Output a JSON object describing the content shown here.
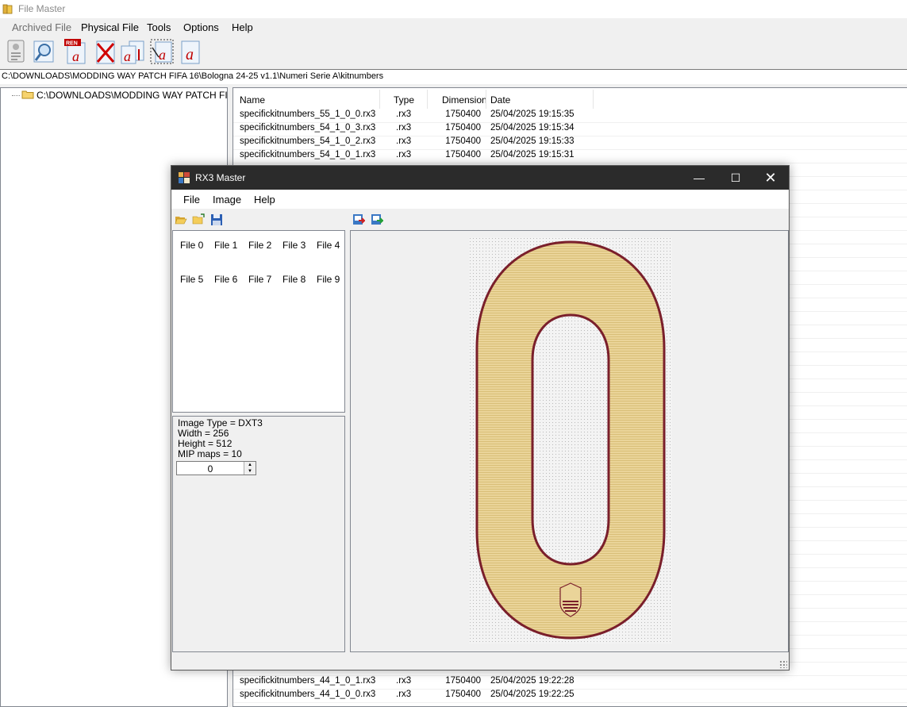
{
  "main": {
    "title": "File Master",
    "menu": [
      "Archived File",
      "Physical File",
      "Tools",
      "Options",
      "Help"
    ],
    "path": "C:\\DOWNLOADS\\MODDING WAY PATCH FIFA 16\\Bologna 24-25 v1.1\\Numeri Serie A\\kitnumbers",
    "tree_root": "C:\\DOWNLOADS\\MODDING WAY PATCH FIFA",
    "columns": {
      "name": "Name",
      "type": "Type",
      "dimension": "Dimension",
      "date": "Date"
    },
    "files_top": [
      {
        "name": "specifickitnumbers_55_1_0_0.rx3",
        "type": ".rx3",
        "dimension": "1750400",
        "date": "25/04/2025 19:15:35"
      },
      {
        "name": "specifickitnumbers_54_1_0_3.rx3",
        "type": ".rx3",
        "dimension": "1750400",
        "date": "25/04/2025 19:15:34"
      },
      {
        "name": "specifickitnumbers_54_1_0_2.rx3",
        "type": ".rx3",
        "dimension": "1750400",
        "date": "25/04/2025 19:15:33"
      },
      {
        "name": "specifickitnumbers_54_1_0_1.rx3",
        "type": ".rx3",
        "dimension": "1750400",
        "date": "25/04/2025 19:15:31"
      }
    ],
    "files_bottom": [
      {
        "name": "specifickitnumbers_44_1_0_1.rx3",
        "type": ".rx3",
        "dimension": "1750400",
        "date": "25/04/2025 19:22:28"
      },
      {
        "name": "specifickitnumbers_44_1_0_0.rx3",
        "type": ".rx3",
        "dimension": "1750400",
        "date": "25/04/2025 19:22:25"
      }
    ],
    "toolbar_badge": "REN"
  },
  "rx3": {
    "title": "RX3 Master",
    "menu": [
      "File",
      "Image",
      "Help"
    ],
    "files": [
      "File 0",
      "File 1",
      "File 2",
      "File 3",
      "File 4",
      "File 5",
      "File 6",
      "File 7",
      "File 8",
      "File 9"
    ],
    "info": {
      "image_type": "Image Type = DXT3",
      "width": "Width = 256",
      "height": "Height = 512",
      "mip_maps": "MIP maps = 10"
    },
    "mip_value": "0",
    "preview_digit": "0",
    "colors": {
      "digit_fill": "#ead499",
      "digit_outline": "#7a1f2b"
    }
  }
}
